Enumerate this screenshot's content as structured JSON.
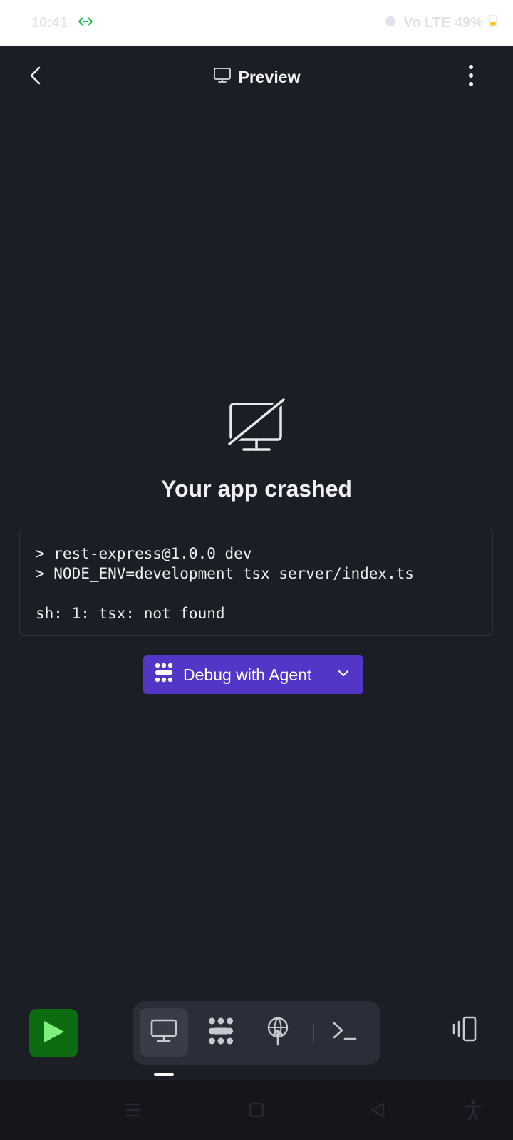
{
  "status_bar": {
    "time": "10:41",
    "indicators": "Vo LTE 49%",
    "battery": "49%"
  },
  "header": {
    "title": "Preview",
    "icons": {
      "back": "chevron-left-icon",
      "title": "monitor-icon",
      "menu": "more-vertical-icon"
    }
  },
  "crash": {
    "icon": "monitor-off-icon",
    "title": "Your app crashed",
    "log": "> rest-express@1.0.0 dev\n> NODE_ENV=development tsx server/index.ts\n\nsh: 1: tsx: not found"
  },
  "debug_button": {
    "label": "Debug with Agent",
    "icon": "agent-icon",
    "dropdown_icon": "chevron-down-icon"
  },
  "toolbar": {
    "run_icon": "play-icon",
    "tabs": [
      {
        "name": "preview",
        "icon": "monitor-icon",
        "active": true
      },
      {
        "name": "agent",
        "icon": "agent-icon",
        "active": false
      },
      {
        "name": "deploy",
        "icon": "deploy-icon",
        "active": false
      },
      {
        "name": "shell",
        "icon": "terminal-icon",
        "active": false
      }
    ],
    "devices_icon": "devices-icon"
  },
  "nav_bar": {
    "icons": [
      "menu-icon",
      "home-icon",
      "back-triangle-icon",
      "accessibility-icon"
    ]
  },
  "colors": {
    "background": "#1c1e26",
    "accent": "#5336c8",
    "run_green": "#0d6b12",
    "tab_group": "#2b2e38"
  }
}
